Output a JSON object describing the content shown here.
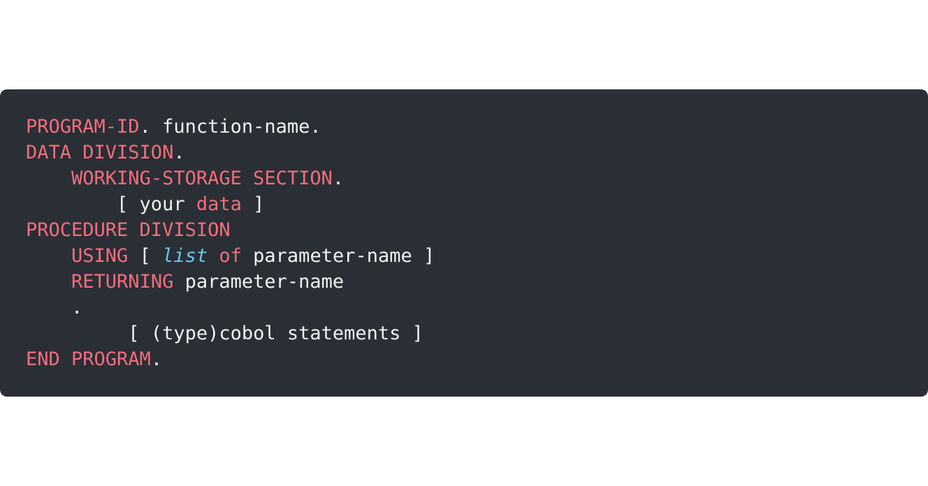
{
  "colors": {
    "background": "#2a2f35",
    "keyword": "#f26d7d",
    "plain": "#f2f2f2",
    "italic_builtin": "#6ec6e8"
  },
  "code_lines": [
    [
      {
        "text": "PROGRAM-ID",
        "style": "keyword"
      },
      {
        "text": ". function-name.",
        "style": "plain"
      }
    ],
    [
      {
        "text": "DATA DIVISION",
        "style": "keyword"
      },
      {
        "text": ".",
        "style": "plain"
      }
    ],
    [
      {
        "text": "    ",
        "style": "plain"
      },
      {
        "text": "WORKING-STORAGE SECTION",
        "style": "keyword"
      },
      {
        "text": ".",
        "style": "plain"
      }
    ],
    [
      {
        "text": "        [ your ",
        "style": "plain"
      },
      {
        "text": "data",
        "style": "keyword"
      },
      {
        "text": " ]",
        "style": "plain"
      }
    ],
    [
      {
        "text": "PROCEDURE DIVISION",
        "style": "keyword"
      }
    ],
    [
      {
        "text": "    ",
        "style": "plain"
      },
      {
        "text": "USING",
        "style": "keyword"
      },
      {
        "text": " [ ",
        "style": "plain"
      },
      {
        "text": "list",
        "style": "italic"
      },
      {
        "text": " ",
        "style": "plain"
      },
      {
        "text": "of",
        "style": "keyword"
      },
      {
        "text": " parameter-name ]",
        "style": "plain"
      }
    ],
    [
      {
        "text": "    ",
        "style": "plain"
      },
      {
        "text": "RETURNING",
        "style": "keyword"
      },
      {
        "text": " parameter-name",
        "style": "plain"
      }
    ],
    [
      {
        "text": "    .",
        "style": "plain"
      }
    ],
    [
      {
        "text": "         [ (type)cobol statements ]",
        "style": "plain"
      }
    ],
    [
      {
        "text": "END PROGRAM",
        "style": "keyword"
      },
      {
        "text": ".",
        "style": "plain"
      }
    ]
  ]
}
